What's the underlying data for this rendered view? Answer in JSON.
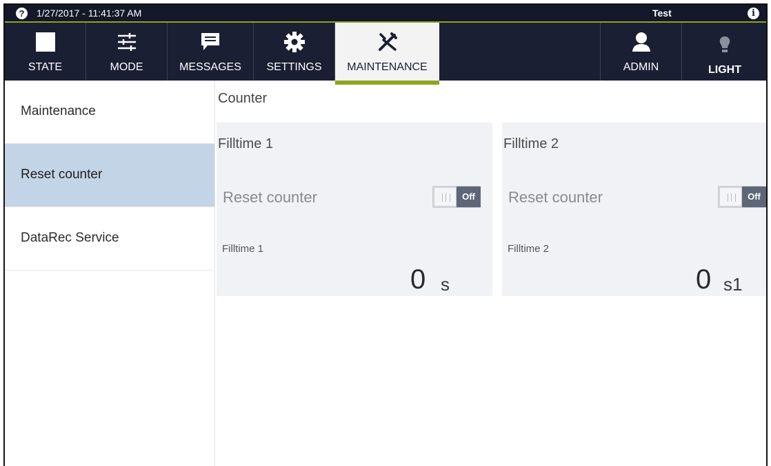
{
  "status": {
    "datetime": "1/27/2017 - 11:41:37 AM",
    "user": "Test",
    "help_icon": "?",
    "info_icon": "i"
  },
  "nav": {
    "state": "STATE",
    "mode": "MODE",
    "messages": "MESSAGES",
    "settings": "SETTINGS",
    "maintenance": "MAINTENANCE",
    "admin": "ADMIN",
    "light": "LIGHT"
  },
  "sidebar": {
    "items": [
      {
        "label": "Maintenance"
      },
      {
        "label": "Reset counter"
      },
      {
        "label": "DataRec Service"
      }
    ]
  },
  "main": {
    "title": "Counter",
    "cards": [
      {
        "title": "Filltime 1",
        "reset_label": "Reset counter",
        "toggle_state": "Off",
        "value_label": "Filltime 1",
        "value": "0",
        "unit": "s"
      },
      {
        "title": "Filltime 2",
        "reset_label": "Reset counter",
        "toggle_state": "Off",
        "value_label": "Filltime 2",
        "value": "0",
        "unit": "s1"
      }
    ]
  },
  "colors": {
    "accent": "#8fa51c",
    "nav_bg": "#1a1f33",
    "selected_bg": "#c3d4e6"
  }
}
